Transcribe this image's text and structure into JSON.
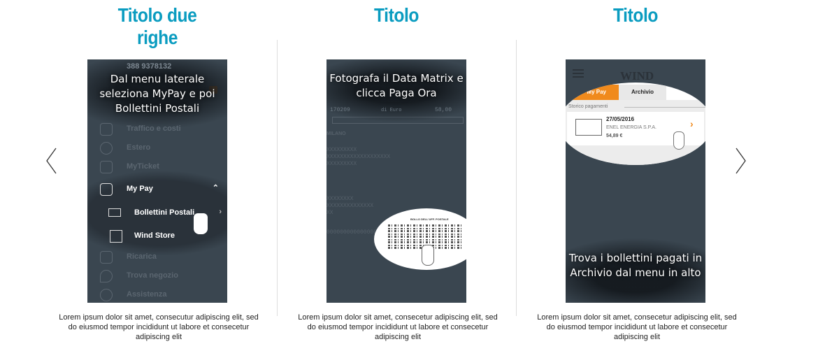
{
  "slides": [
    {
      "title": "Titolo due righe",
      "overlay": "Dal menu laterale seleziona MyPay e poi Bollettini Postali",
      "phone": {
        "number": "388 9378132",
        "badge": "2",
        "menu": [
          {
            "label": "Traffico e costi",
            "icon": "traffic-icon"
          },
          {
            "label": "Estero",
            "icon": "globe-icon"
          },
          {
            "label": "MyTicket",
            "icon": "bus-icon"
          },
          {
            "label": "My Pay",
            "icon": "card-icon"
          },
          {
            "label": "Bollettini Postali",
            "icon": "bill-icon"
          },
          {
            "label": "Wind Store",
            "icon": "cart-icon"
          },
          {
            "label": "Ricarica",
            "icon": "fuel-icon"
          },
          {
            "label": "Trova negozio",
            "icon": "pin-icon"
          },
          {
            "label": "Assistenza",
            "icon": "help-icon"
          }
        ]
      },
      "caption": "Lorem ipsum dolor sit amet, consecutur adipiscing elit, sed do eiusmod tempor incididunt ut labore et consecetur adipiscing elit"
    },
    {
      "title": "Titolo",
      "overlay": "Fotografa il Data Matrix e clicca Paga Ora",
      "phone": {
        "code": "170209",
        "currency": "di Euro",
        "amount": "58,00",
        "city": "MILANO",
        "lines": [
          "XXXXXXXXX",
          "XXXXXXXXXXXXXXXXXXX",
          "XXXXXXXXX",
          "XXXXXXXX",
          "XXXXXXXXXXXXXX",
          "XX",
          "0000000000000000"
        ],
        "stamp": "BOLLO DELL'UFF. POSTALE"
      },
      "caption": "Lorem ipsum dolor sit amet, consecetur adipiscing elit, sed do eiusmod tempor incididunt ut labore et consecetur adipiscing elit"
    },
    {
      "title": "Titolo",
      "overlay": "Trova i bollettini pagati in Archivio dal menu in alto",
      "phone": {
        "brand": "WIND",
        "tabs": [
          "My Pay",
          "Archivio"
        ],
        "section": "Storico pagamenti",
        "entry": {
          "date": "27/05/2016",
          "payee": "ENEL ENERGIA S.P.A.",
          "amount": "54,89 €"
        }
      },
      "caption": "Lorem ipsum dolor sit amet, consecetur adipiscing elit, sed do eiusmod tempor incididunt ut labore et consecetur adipiscing elit"
    }
  ],
  "colors": {
    "title": "#0a9cc0",
    "accent": "#f08a1c",
    "screen": "#3a4650"
  }
}
